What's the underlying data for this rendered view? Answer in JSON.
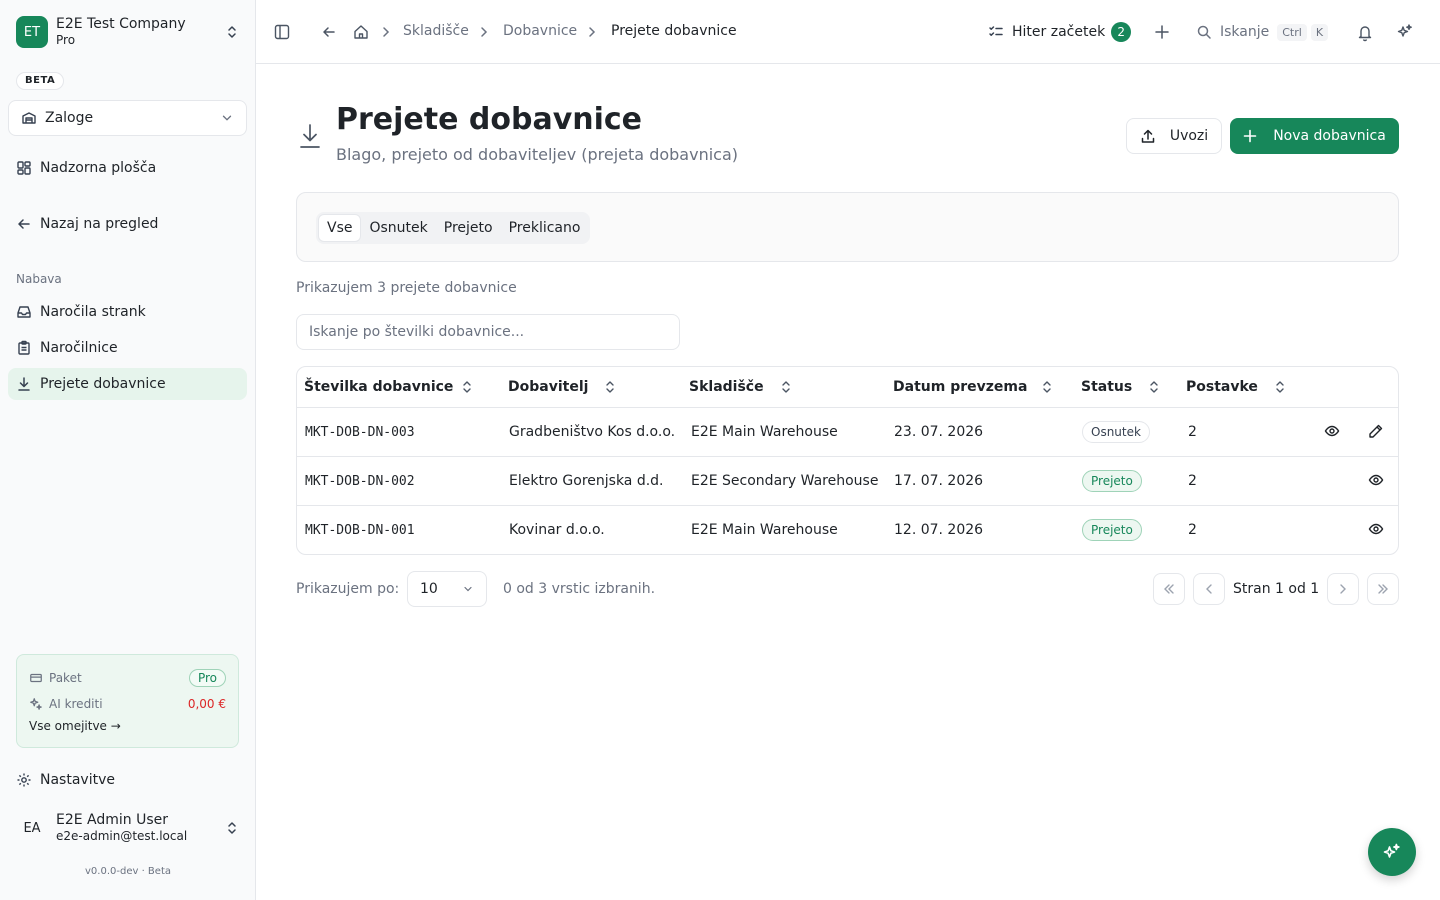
{
  "sidebar": {
    "company": {
      "initials": "ET",
      "name": "E2E Test Company",
      "plan": "Pro"
    },
    "beta_label": "BETA",
    "module_select": {
      "value": "Zaloge"
    },
    "dashboard_label": "Nadzorna plošča",
    "back_label": "Nazaj na pregled",
    "section_label": "Nabava",
    "items": [
      {
        "label": "Naročila strank",
        "icon": "inbox-icon"
      },
      {
        "label": "Naročilnice",
        "icon": "clipboard-icon"
      },
      {
        "label": "Prejete dobavnice",
        "icon": "download-icon",
        "active": true
      }
    ],
    "plan_card": {
      "plan_label": "Paket",
      "plan_value": "Pro",
      "ai_label": "AI krediti",
      "ai_value": "0,00 €",
      "limits_link": "Vse omejitve →"
    },
    "settings_label": "Nastavitve",
    "user": {
      "initials": "EA",
      "name": "E2E Admin User",
      "email": "e2e-admin@test.local"
    },
    "version": "v0.0.0-dev · Beta"
  },
  "topbar": {
    "breadcrumbs": [
      "Skladišče",
      "Dobavnice",
      "Prejete dobavnice"
    ],
    "quick_start": {
      "label": "Hiter začetek",
      "count": "2"
    },
    "search": {
      "label": "Iskanje",
      "shortcut_mod": "Ctrl",
      "shortcut_key": "K"
    }
  },
  "page": {
    "title": "Prejete dobavnice",
    "subtitle": "Blago, prejeto od dobaviteljev (prejeta dobavnica)",
    "import_label": "Uvozi",
    "new_label": "Nova dobavnica"
  },
  "tabs": [
    {
      "label": "Vse",
      "active": true
    },
    {
      "label": "Osnutek"
    },
    {
      "label": "Prejeto"
    },
    {
      "label": "Preklicano"
    }
  ],
  "results_text": "Prikazujem 3 prejete dobavnice",
  "search": {
    "placeholder": "Iskanje po številki dobavnice...",
    "value": ""
  },
  "table": {
    "columns": [
      "Številka dobavnice",
      "Dobavitelj",
      "Skladišče",
      "Datum prevzema",
      "Status",
      "Postavke"
    ],
    "rows": [
      {
        "number": "MKT-DOB-DN-003",
        "supplier": "Gradbeništvo Kos d.o.o.",
        "warehouse": "E2E Main Warehouse",
        "date": "23. 07. 2026",
        "status": "Osnutek",
        "status_kind": "draft",
        "items": "2",
        "editable": true
      },
      {
        "number": "MKT-DOB-DN-002",
        "supplier": "Elektro Gorenjska d.d.",
        "warehouse": "E2E Secondary Warehouse",
        "date": "17. 07. 2026",
        "status": "Prejeto",
        "status_kind": "received",
        "items": "2",
        "editable": false
      },
      {
        "number": "MKT-DOB-DN-001",
        "supplier": "Kovinar d.o.o.",
        "warehouse": "E2E Main Warehouse",
        "date": "12. 07. 2026",
        "status": "Prejeto",
        "status_kind": "received",
        "items": "2",
        "editable": false
      }
    ]
  },
  "pagination": {
    "rows_per_page_label": "Prikazujem po:",
    "page_size": "10",
    "selected_text": "0 od 3 vrstic izbranih.",
    "page_info": "Stran 1 od 1"
  },
  "colors": {
    "accent": "#17875a",
    "accent_soft": "#e6f4ec",
    "danger": "#dc2626"
  }
}
